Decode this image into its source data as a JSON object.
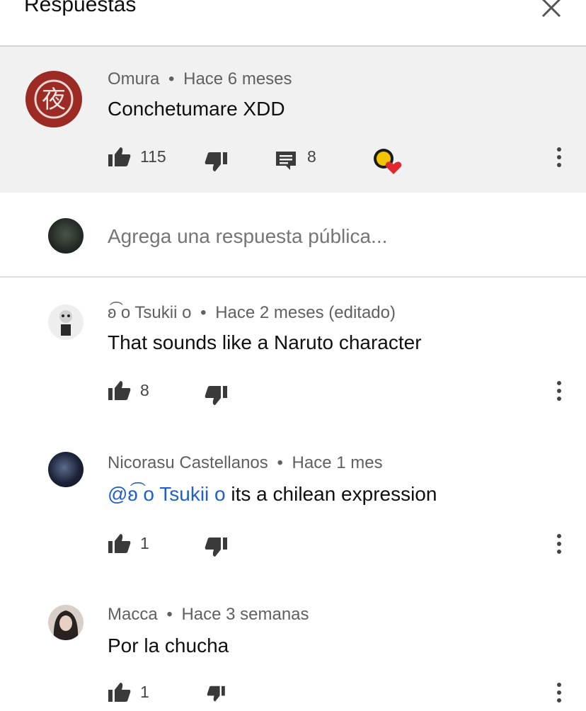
{
  "header": {
    "title": "Respuestas"
  },
  "parent_comment": {
    "author": "Omura",
    "time": "Hace 6 meses",
    "text": "Conchetumare XDD",
    "likes": "115",
    "replies": "8",
    "avatar_glyph": "夜"
  },
  "reply_box": {
    "placeholder": "Agrega una respuesta pública..."
  },
  "replies": [
    {
      "author": "ʚ͡ o Tsukii o",
      "time": "Hace 2 meses (editado)",
      "text": "That sounds like a Naruto character",
      "likes": "8"
    },
    {
      "author": "Nicorasu Castellanos",
      "time": "Hace 1 mes",
      "mention": "@ʚ͡ o Tsukii o",
      "text": " its a chilean expression",
      "likes": "1"
    },
    {
      "author": "Macca",
      "time": "Hace 3 semanas",
      "text": "Por la chucha",
      "likes": "1"
    }
  ],
  "separator": "•",
  "colors": {
    "accent_link": "#1f5fcf",
    "parent_bg": "#f1f1f1",
    "heart": "#e0282f",
    "creator_badge": "#f5c400"
  },
  "icons": [
    "close-icon",
    "like-icon",
    "dislike-icon",
    "reply-icon",
    "creator-heart-icon",
    "more-vert-icon"
  ]
}
